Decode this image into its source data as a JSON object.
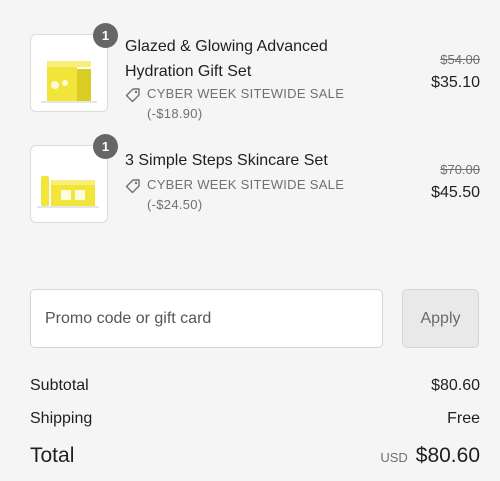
{
  "line_items": [
    {
      "quantity": "1",
      "name": "Glazed & Glowing Advanced Hydration Gift Set",
      "discount": "CYBER WEEK SITEWIDE SALE (-$18.90)",
      "original_price": "$54.00",
      "price": "$35.10",
      "thumb_icon": "gift-box-image"
    },
    {
      "quantity": "1",
      "name": "3 Simple Steps Skincare Set",
      "discount": "CYBER WEEK SITEWIDE SALE (-$24.50)",
      "original_price": "$70.00",
      "price": "$45.50",
      "thumb_icon": "skincare-set-image"
    }
  ],
  "promo": {
    "placeholder": "Promo code or gift card",
    "apply_label": "Apply"
  },
  "summary": {
    "subtotal_label": "Subtotal",
    "subtotal_value": "$80.60",
    "shipping_label": "Shipping",
    "shipping_value": "Free",
    "total_label": "Total",
    "currency": "USD",
    "total_value": "$80.60"
  },
  "colors": {
    "background": "#f5f5f5",
    "badge": "#666666",
    "product_yellow": "#f2e53a"
  }
}
